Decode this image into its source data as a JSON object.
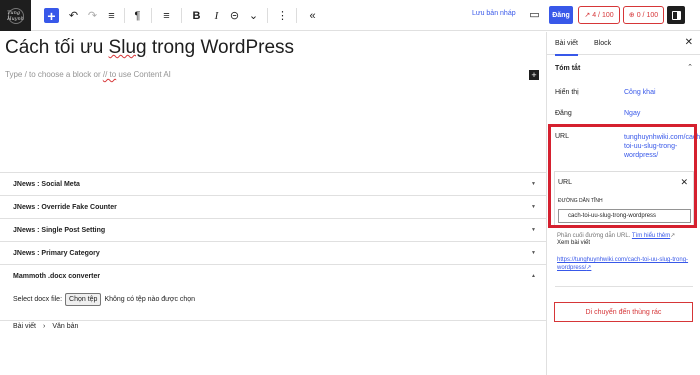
{
  "topbar": {
    "logo_text": "Tung Huynh",
    "add_label": "+",
    "undo_icon": "↶",
    "redo_icon": "↷",
    "outline_icon": "≡",
    "paragraph_icon": "¶",
    "align_icon": "≡",
    "bold_label": "B",
    "italic_label": "I",
    "link_icon": "⊝",
    "more_icon": "⌄",
    "options_icon": "⋮",
    "collapse_icon": "«",
    "save_draft": "Lưu bản nháp",
    "preview_icon": "▭",
    "publish": "Đăng",
    "seo_score": "4 / 100",
    "readability_score": "0 / 100"
  },
  "editor": {
    "title_before": "Cách tối ưu ",
    "title_misspelled": "Slug",
    "title_after": " trong WordPress",
    "placeholder_before": "Type / to choose a block or ",
    "placeholder_misspelled": "// to",
    "placeholder_after": " use Content AI",
    "inline_add": "+"
  },
  "metaboxes": [
    {
      "label": "JNews : Social Meta",
      "caret": "▼"
    },
    {
      "label": "JNews : Override Fake Counter",
      "caret": "▼"
    },
    {
      "label": "JNews : Single Post Setting",
      "caret": "▼"
    },
    {
      "label": "JNews : Primary Category",
      "caret": "▼"
    },
    {
      "label": "Mammoth .docx converter",
      "caret": "▲"
    }
  ],
  "docx": {
    "label": "Select docx file:",
    "button": "Chọn tệp",
    "status": "Không có tệp nào được chọn"
  },
  "breadcrumb": {
    "items": [
      "Bài viết",
      "Văn bản"
    ],
    "separator": "›"
  },
  "sidebar": {
    "tab_post": "Bài viết",
    "tab_block": "Block",
    "close": "✕",
    "summary_title": "Tóm tắt",
    "summary_chevron": "⌃",
    "visibility_label": "Hiển thị",
    "visibility_value": "Công khai",
    "publish_label": "Đăng",
    "publish_value": "Ngay",
    "url_label": "URL",
    "url_value": "tunghuynhwiki.com/cach-toi-uu-slug-trong-wordpress/",
    "popover": {
      "title": "URL",
      "close": "✕",
      "slug_label": "ĐƯỜNG DẪN TĨNH",
      "slug_value": "cach-toi-uu-slug-trong-wordpress"
    },
    "help_text": "Phần cuối đường dẫn URL.",
    "help_link": "Tìm hiểu thêm",
    "view_label": "Xem bài viết",
    "view_link": "https://tunghuynhwiki.com/cach-toi-uu-slug-trong-wordpress/",
    "trash": "Di chuyển đến thùng rác"
  },
  "colors": {
    "accent": "#3858e9",
    "highlight": "#d5202f",
    "seo_red": "#d63638"
  }
}
